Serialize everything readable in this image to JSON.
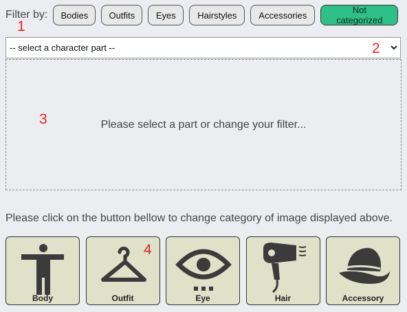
{
  "filter": {
    "label": "Filter by:",
    "buttons": [
      {
        "label": "Bodies",
        "active": false
      },
      {
        "label": "Outfits",
        "active": false
      },
      {
        "label": "Eyes",
        "active": false
      },
      {
        "label": "Hairstyles",
        "active": false
      },
      {
        "label": "Accessories",
        "active": false
      },
      {
        "label": "Not categorized",
        "active": true
      }
    ]
  },
  "select": {
    "value": "-- select a character part --"
  },
  "preview": {
    "message": "Please select a part or change your filter..."
  },
  "instruction": "Please click on the button bellow to change category of image displayed above.",
  "categories": [
    {
      "label": "Body",
      "icon": "body-icon"
    },
    {
      "label": "Outfit",
      "icon": "hanger-icon"
    },
    {
      "label": "Eye",
      "icon": "eye-icon"
    },
    {
      "label": "Hair",
      "icon": "hair-dryer-icon"
    },
    {
      "label": "Accessory",
      "icon": "hat-icon"
    }
  ],
  "markers": [
    "1",
    "2",
    "3",
    "4"
  ],
  "colors": {
    "active_filter": "#2fc08a",
    "category_bg": "#dfe1c9",
    "marker": "#e8231f"
  }
}
